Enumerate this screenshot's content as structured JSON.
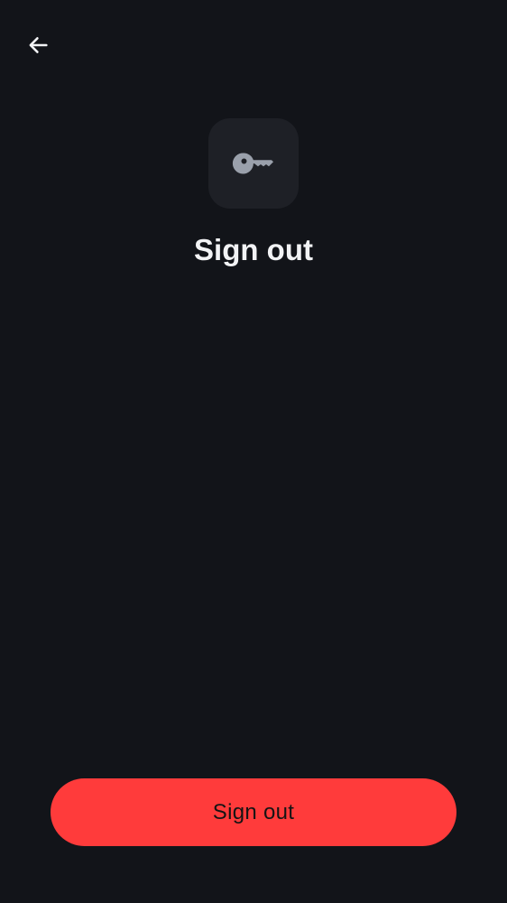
{
  "header": {
    "back_icon": "arrow-left-icon"
  },
  "hero": {
    "icon": "key-icon",
    "title": "Sign out"
  },
  "actions": {
    "primary_label": "Sign out"
  },
  "colors": {
    "background": "#121419",
    "tile": "#1e2026",
    "icon": "#9aa0ab",
    "title": "#f2f3f5",
    "danger": "#ff3b3b"
  }
}
